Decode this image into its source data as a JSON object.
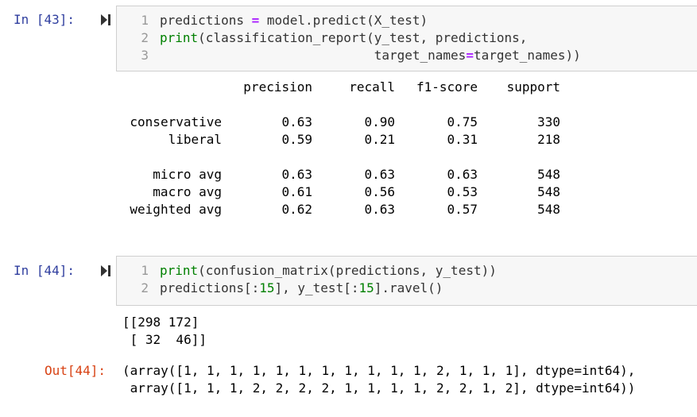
{
  "cell43": {
    "prompt": "In [43]:",
    "lines": [
      {
        "num": "1",
        "parts": [
          {
            "t": "predictions ",
            "c": ""
          },
          {
            "t": "=",
            "c": "op"
          },
          {
            "t": " model.predict(X_test)",
            "c": ""
          }
        ]
      },
      {
        "num": "2",
        "parts": [
          {
            "t": "print",
            "c": "kw"
          },
          {
            "t": "(classification_report(y_test, predictions,",
            "c": ""
          }
        ]
      },
      {
        "num": "3",
        "parts": [
          {
            "t": "                            target_names",
            "c": ""
          },
          {
            "t": "=",
            "c": "op"
          },
          {
            "t": "target_names))",
            "c": ""
          }
        ]
      }
    ],
    "report": {
      "headers": [
        "precision",
        "recall",
        "f1-score",
        "support"
      ],
      "rows": [
        {
          "label": "conservative",
          "precision": "0.63",
          "recall": "0.90",
          "f1": "0.75",
          "support": "330"
        },
        {
          "label": "liberal",
          "precision": "0.59",
          "recall": "0.21",
          "f1": "0.31",
          "support": "218"
        },
        {
          "label": "micro avg",
          "precision": "0.63",
          "recall": "0.63",
          "f1": "0.63",
          "support": "548"
        },
        {
          "label": "macro avg",
          "precision": "0.61",
          "recall": "0.56",
          "f1": "0.53",
          "support": "548"
        },
        {
          "label": "weighted avg",
          "precision": "0.62",
          "recall": "0.63",
          "f1": "0.57",
          "support": "548"
        }
      ]
    }
  },
  "cell44": {
    "prompt": "In [44]:",
    "out_prompt": "Out[44]:",
    "lines": [
      {
        "num": "1",
        "parts": [
          {
            "t": "print",
            "c": "kw"
          },
          {
            "t": "(confusion_matrix(predictions, y_test))",
            "c": ""
          }
        ]
      },
      {
        "num": "2",
        "parts": [
          {
            "t": "predictions[:",
            "c": ""
          },
          {
            "t": "15",
            "c": "num"
          },
          {
            "t": "], y_test[:",
            "c": ""
          },
          {
            "t": "15",
            "c": "num"
          },
          {
            "t": "].ravel()",
            "c": ""
          }
        ]
      }
    ],
    "stdout": [
      "[[298 172]",
      " [ 32  46]]"
    ],
    "result": [
      "(array([1, 1, 1, 1, 1, 1, 1, 1, 1, 1, 1, 2, 1, 1, 1], dtype=int64),",
      " array([1, 1, 1, 2, 2, 2, 2, 1, 1, 1, 1, 2, 2, 1, 2], dtype=int64))"
    ]
  },
  "icons": {
    "run": "run-cell-icon"
  },
  "colors": {
    "in_prompt": "#303f9f",
    "out_prompt": "#d84315",
    "keyword": "#008000",
    "operator": "#aa22ff"
  }
}
